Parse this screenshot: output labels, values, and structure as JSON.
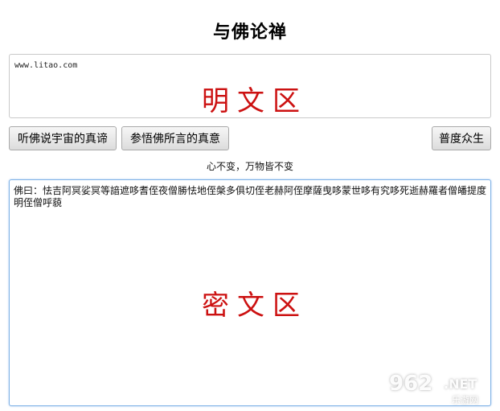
{
  "page": {
    "title": "与佛论禅"
  },
  "plain_area": {
    "value": "www.litao.com",
    "watermark": "明文区"
  },
  "buttons": {
    "listen_label": "听佛说宇宙的真谛",
    "realize_label": "参悟佛所言的真意",
    "save_label": "普度众生"
  },
  "motto": "心不变，万物皆不变",
  "cipher_area": {
    "value": "佛曰：怯吉阿冥娑冥等諳遮哆耆侄夜僧勝怯地侄槃多俱切侄老赫阿侄摩薩曳哆蒙世哆有究哆死逝赫羅者僧皤提度明侄僧呼藐",
    "watermark": "密文区"
  },
  "site_logo": {
    "number": "962",
    "suffix": ".NET",
    "subtitle": "乐游网"
  }
}
